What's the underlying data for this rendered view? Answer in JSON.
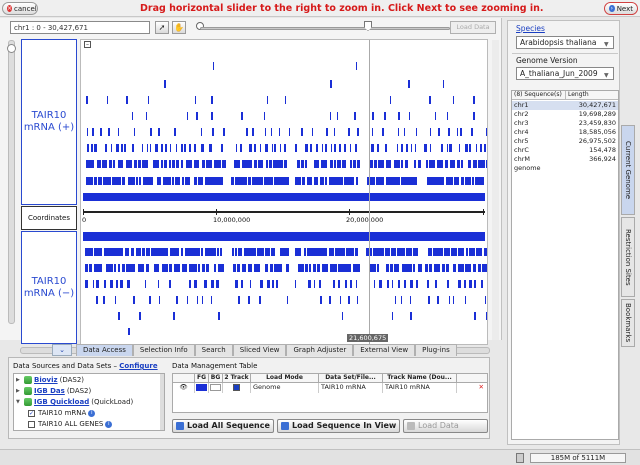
{
  "banner": {
    "cancel_label": "cancel",
    "message": "Drag horizontal slider to the right to zoom in. Click Next to see zooming in.",
    "next_label": "Next"
  },
  "toolbar": {
    "location": "chr1 : 0 - 30,427,671",
    "load_data_label": "Load Data"
  },
  "tracks": {
    "plus_label": "TAIR10 mRNA (+)",
    "coord_label": "Coordinates",
    "minus_label": "TAIR10 mRNA (−)"
  },
  "ruler": {
    "tick_0": "0",
    "tick_10m": "10,000,000",
    "tick_20m": "20,000,000",
    "position": "21,600,675"
  },
  "tabs": [
    {
      "label": "Data Access"
    },
    {
      "label": "Selection Info"
    },
    {
      "label": "Search"
    },
    {
      "label": "Sliced View"
    },
    {
      "label": "Graph Adjuster"
    },
    {
      "label": "External View"
    },
    {
      "label": "Plug-ins"
    }
  ],
  "data_sources": {
    "title": "Data Sources and Data Sets –",
    "configure": "Configure",
    "items": [
      {
        "name": "Bioviz",
        "type": "(DAS2)"
      },
      {
        "name": "IGB Das",
        "type": "(DAS2)"
      },
      {
        "name": "IGB Quickload",
        "type": "(QuickLoad)"
      },
      {
        "name": "TAIR10 mRNA"
      },
      {
        "name": "TAIR10 ALL GENES"
      }
    ]
  },
  "data_management": {
    "title": "Data Management Table",
    "headers": [
      "FG",
      "BG",
      "2 Track",
      "Load Mode",
      "Data Set/File...",
      "Track Name (Dou..."
    ],
    "row": {
      "load_mode": "Genome",
      "data_set": "TAIR10 mRNA",
      "track_name": "TAIR10 mRNA"
    },
    "btn_load_all": "Load All Sequence",
    "btn_load_in_view": "Load Sequence In View",
    "btn_load_data": "Load Data"
  },
  "status": {
    "memory": "185M of 5111M"
  },
  "right_panel": {
    "species_label": "Species",
    "species_value": "Arabidopsis thaliana",
    "genome_label": "Genome Version",
    "genome_value": "A_thaliana_Jun_2009",
    "seq_count_header": "(8) Sequence(s)",
    "length_header": "Length",
    "sequences": [
      {
        "name": "chr1",
        "length": "30,427,671"
      },
      {
        "name": "chr2",
        "length": "19,698,289"
      },
      {
        "name": "chr3",
        "length": "23,459,830"
      },
      {
        "name": "chr4",
        "length": "18,585,056"
      },
      {
        "name": "chr5",
        "length": "26,975,502"
      },
      {
        "name": "chrC",
        "length": "154,478"
      },
      {
        "name": "chrM",
        "length": "366,924"
      },
      {
        "name": "genome",
        "length": ""
      }
    ],
    "side_tabs": [
      "Current Genome",
      "Restriction Sites",
      "Bookmarks"
    ]
  },
  "colors": {
    "feature": "#1a2fd6",
    "banner_text": "#d61a1a",
    "link": "#1a3fc2"
  }
}
